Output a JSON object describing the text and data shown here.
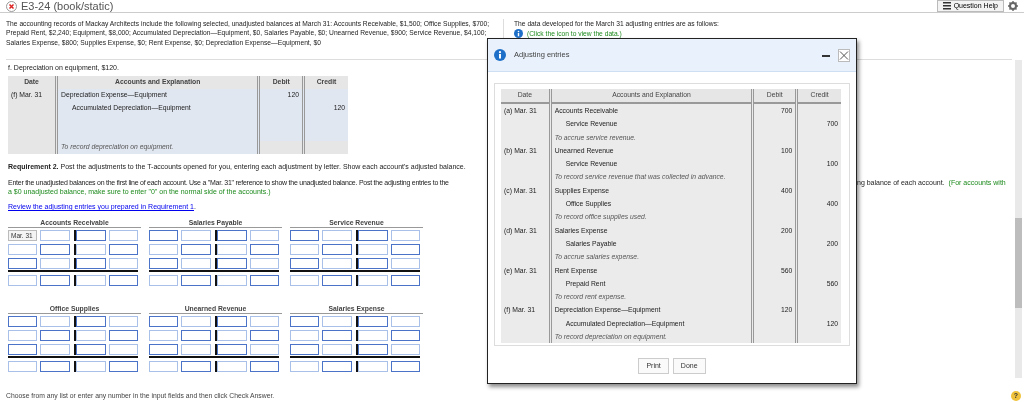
{
  "header": {
    "title": "E3-24 (book/static)",
    "help_button": "Question Help"
  },
  "problem": {
    "text": "The accounting records of Mackay Architects include the following selected, unadjusted balances at March 31: Accounts Receivable, $1,500; Office Supplies, $700; Prepaid Rent,  $2,240; Equipment, $8,000; Accumulated Depreciation—Equipment, $0, Salaries Payable, $0; Unearned Revenue, $900; Service Revenue, $4,100; Salaries Expense, $800; Supplies Expense, $0; Rent Expense, $0; Depreciation Expense—Equipment, $0",
    "data_note": "The data developed for the March 31 adjusting entries are as follows:",
    "data_link": "(Click the icon to view the data.)"
  },
  "journal": {
    "prompt": "f. Depreciation on equipment, $120.",
    "columns": [
      "Date",
      "Accounts and Explanation",
      "Debit",
      "Credit"
    ],
    "entry": {
      "date": "(f) Mar. 31",
      "lines": [
        {
          "account": "Depreciation Expense—Equipment",
          "kind": "debit",
          "amount": "120"
        },
        {
          "account": "Accumulated Depreciation—Equipment",
          "kind": "credit",
          "amount": "120"
        }
      ],
      "explanation": "To record depreciation on equipment."
    }
  },
  "requirement_2": "**Requirement 2.** Post the adjustments to the T-accounts opened for you, entering each adjustment by letter. Show each account's adjusted balance.",
  "instructions": {
    "left": "Enter the unadjusted balances on the first line of each account. Use a \"Mar. 31\" reference to show the unadjusted balance. Post the adjusting entries to the",
    "right": "ng balance of each account.",
    "note_right": "(For accounts with",
    "note_left": "a $0 unadjusted balance, make sure to enter \"0\" on the normal side of the accounts.)"
  },
  "review": {
    "link": "Review the adjusting entries you prepared in Requirement 1",
    "suffix": "."
  },
  "t_accounts": [
    {
      "title": "Accounts Receivable",
      "date": "Mar. 31"
    },
    {
      "title": "Salaries Payable"
    },
    {
      "title": "Service Revenue"
    },
    {
      "title": "Office Supplies"
    },
    {
      "title": "Unearned Revenue"
    },
    {
      "title": "Salaries Expense"
    }
  ],
  "footer": "Choose from any list or enter any number in the input fields and then click Check Answer.",
  "help_icon": "?",
  "modal": {
    "title": "Adjusting entries",
    "columns": [
      "Date",
      "Accounts and Explanation",
      "Debit",
      "Credit"
    ],
    "entries": [
      {
        "date": "(a) Mar. 31",
        "lines": [
          {
            "account": "Accounts Receivable",
            "kind": "debit",
            "amount": "700"
          },
          {
            "account": "Service Revenue",
            "kind": "credit",
            "amount": "700"
          }
        ],
        "explanation": "To accrue service revenue."
      },
      {
        "date": "(b) Mar. 31",
        "lines": [
          {
            "account": "Unearned Revenue",
            "kind": "debit",
            "amount": "100"
          },
          {
            "account": "Service Revenue",
            "kind": "credit",
            "amount": "100"
          }
        ],
        "explanation": "To record service revenue that was collected in advance."
      },
      {
        "date": "(c) Mar. 31",
        "lines": [
          {
            "account": "Supplies Expense",
            "kind": "debit",
            "amount": "400"
          },
          {
            "account": "Office Supplies",
            "kind": "credit",
            "amount": "400"
          }
        ],
        "explanation": "To record office supplies used."
      },
      {
        "date": "(d) Mar. 31",
        "lines": [
          {
            "account": "Salaries Expense",
            "kind": "debit",
            "amount": "200"
          },
          {
            "account": "Salaries Payable",
            "kind": "credit",
            "amount": "200"
          }
        ],
        "explanation": "To accrue salaries expense."
      },
      {
        "date": "(e) Mar. 31",
        "lines": [
          {
            "account": "Rent Expense",
            "kind": "debit",
            "amount": "560"
          },
          {
            "account": "Prepaid Rent",
            "kind": "credit",
            "amount": "560"
          }
        ],
        "explanation": "To record rent expense."
      },
      {
        "date": "(f) Mar. 31",
        "lines": [
          {
            "account": "Depreciation Expense—Equipment",
            "kind": "debit",
            "amount": "120"
          },
          {
            "account": "Accumulated Depreciation—Equipment",
            "kind": "credit",
            "amount": "120"
          }
        ],
        "explanation": "To record depreciation on equipment."
      }
    ],
    "buttons": [
      "Print",
      "Done"
    ]
  }
}
